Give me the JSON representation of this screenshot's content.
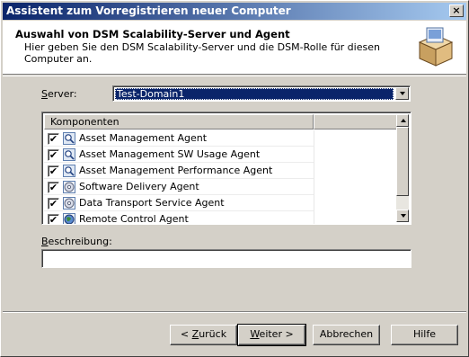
{
  "window": {
    "title": "Assistent zum Vorregistrieren neuer Computer",
    "close_label": "×"
  },
  "header": {
    "title": "Auswahl von DSM Scalability-Server und Agent",
    "subtitle": "Hier geben Sie den DSM Scalability-Server und die DSM-Rolle für diesen Computer an.",
    "icon": "box-icon"
  },
  "server": {
    "label_prefix": "S",
    "label_rest": "erver:",
    "value": "Test-Domain1"
  },
  "list": {
    "column_header": "Komponenten",
    "rows": [
      {
        "label": "Asset Management Agent",
        "checked": true,
        "icon": "magnifier-icon"
      },
      {
        "label": "Asset Management SW Usage Agent",
        "checked": true,
        "icon": "magnifier-icon"
      },
      {
        "label": "Asset Management Performance Agent",
        "checked": true,
        "icon": "magnifier-icon"
      },
      {
        "label": "Software Delivery Agent",
        "checked": true,
        "icon": "cd-icon"
      },
      {
        "label": "Data Transport Service Agent",
        "checked": true,
        "icon": "cd-icon"
      },
      {
        "label": "Remote Control Agent",
        "checked": true,
        "icon": "globe-icon"
      }
    ]
  },
  "description": {
    "label_prefix": "B",
    "label_rest": "eschreibung:",
    "value": ""
  },
  "buttons": {
    "back_pre": "< ",
    "back_u": "Z",
    "back_post": "urück",
    "next_u": "W",
    "next_post": "eiter >",
    "cancel": "Abbrechen",
    "help": "Hilfe"
  },
  "check_mark": "✔"
}
